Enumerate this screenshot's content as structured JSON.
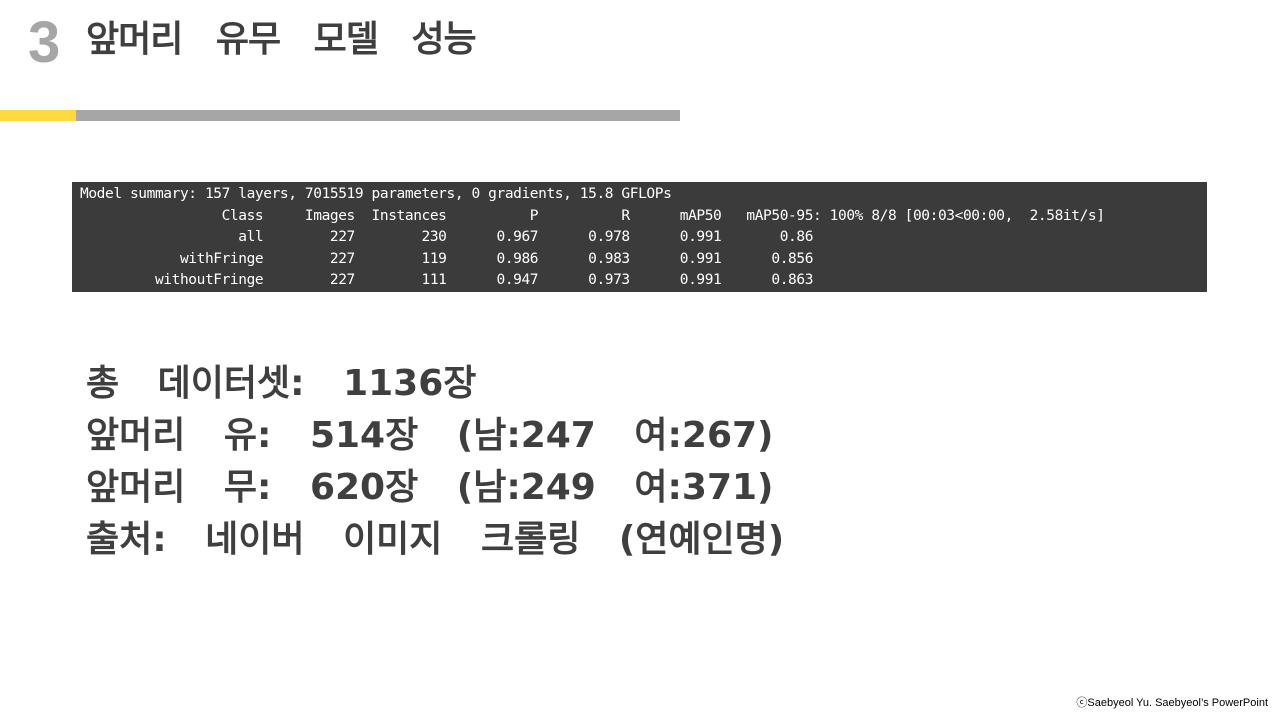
{
  "slide": {
    "number": "3",
    "title": "앞머리 유무 모델 성능"
  },
  "terminal": {
    "lines": [
      "Model summary: 157 layers, 7015519 parameters, 0 gradients, 15.8 GFLOPs",
      "                 Class     Images  Instances          P          R      mAP50   mAP50-95: 100% 8/8 [00:03<00:00,  2.58it/s]",
      "                   all        227        230      0.967      0.978      0.991       0.86",
      "            withFringe        227        119      0.986      0.983      0.991      0.856",
      "         withoutFringe        227        111      0.947      0.973      0.991      0.863"
    ]
  },
  "stats": {
    "total": "총 데이터셋: 1136장",
    "with_fringe": "앞머리 유: 514장 (남:247 여:267)",
    "without_fringe": "앞머리 무: 620장 (남:249 여:371)",
    "source": "출처: 네이버 이미지 크롤링 (연예인명)"
  },
  "footer": {
    "copyright": "ⓒSaebyeol Yu. Saebyeol’s PowerPoint"
  },
  "colors": {
    "accent_yellow": "#ffd93f",
    "accent_gray": "#a6a6a6",
    "terminal_bg": "#3b3b3b",
    "title_text": "#3f3f3f"
  }
}
